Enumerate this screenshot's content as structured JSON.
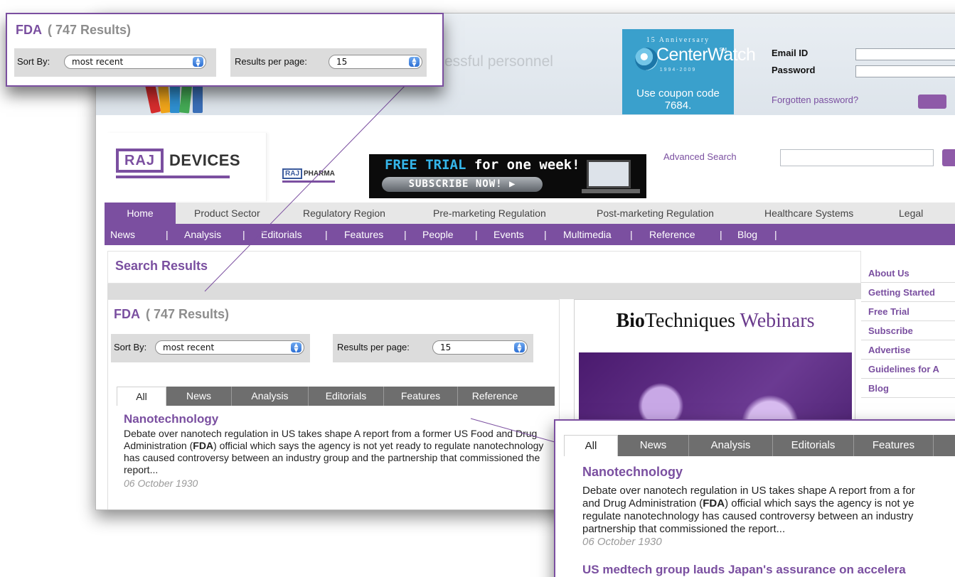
{
  "banner": {
    "tagline": "essful personnel",
    "login": {
      "email_label": "Email ID",
      "password_label": "Password",
      "forgot": "Forgotten password?"
    }
  },
  "centerwatch": {
    "anniversary": "15 Anniversary",
    "name": "CenterWatch",
    "sm": "SM",
    "years": "1994-2009",
    "coupon": "Use coupon code 7684."
  },
  "header": {
    "logo_box": "RAJ",
    "logo_word": "DEVICES",
    "pharma_box": "RAJ",
    "pharma_word": "PHARMA",
    "trial": {
      "free": "FREE TRIAL",
      "rest": " for one week!",
      "cta": "SUBSCRIBE NOW!  ▶"
    },
    "advanced_search": "Advanced Search"
  },
  "nav_primary": [
    "Home",
    "Product Sector",
    "Regulatory Region",
    "Pre-marketing Regulation",
    "Post-marketing Regulation",
    "Healthcare Systems",
    "Legal"
  ],
  "nav_secondary": [
    "News",
    "|",
    "Analysis",
    "|",
    "Editorials",
    "|",
    "Features",
    "|",
    "People",
    "|",
    "Events",
    "|",
    "Multimedia",
    "|",
    "Reference",
    "|",
    "Blog",
    "|"
  ],
  "search": {
    "page_title": "Search Results",
    "query": "FDA",
    "count": "( 747 Results)",
    "sort_label": "Sort By:",
    "sort_value": "most recent",
    "per_page_label": "Results per page:",
    "per_page_value": "15",
    "tabs": [
      "All",
      "News",
      "Analysis",
      "Editorials",
      "Features",
      "Reference"
    ],
    "results": [
      {
        "title": "Nanotechnology",
        "snippet_pre": "Debate over nanotech regulation in US takes shape A report from a former US Food and Drug Administration (",
        "snippet_bold": "FDA",
        "snippet_post": ") official which says the agency is not yet ready to regulate nanotechnology has caused controversy between an industry group and the partnership that commissioned the report...",
        "date": "06 October 1930"
      },
      {
        "title": "US medtech group lauds Japan's assurance on accelera"
      }
    ]
  },
  "zoom_bottom": {
    "tab_f": "F",
    "line1": "Debate over nanotech regulation in US takes shape A report from a for",
    "line2a": "and Drug Administration (",
    "line2b": "FDA",
    "line2c": ") official which says the agency is not ye",
    "line3": "regulate nanotechnology has caused controversy between an industry",
    "line4": "partnership that commissioned the report..."
  },
  "sidebar_links": [
    "About Us",
    "Getting Started",
    "Free Trial",
    "Subscribe",
    "Advertise",
    "Guidelines for A",
    "Blog"
  ],
  "ad": {
    "brand_bold": "Bio",
    "brand_rest": "Techniques",
    "brand_tail": " Webinars"
  },
  "colors": {
    "brand_purple": "#7b4fa0",
    "link_purple": "#7a4fa0",
    "centerwatch_blue": "#3aa0cc",
    "tab_gray": "#6e6e6e"
  }
}
